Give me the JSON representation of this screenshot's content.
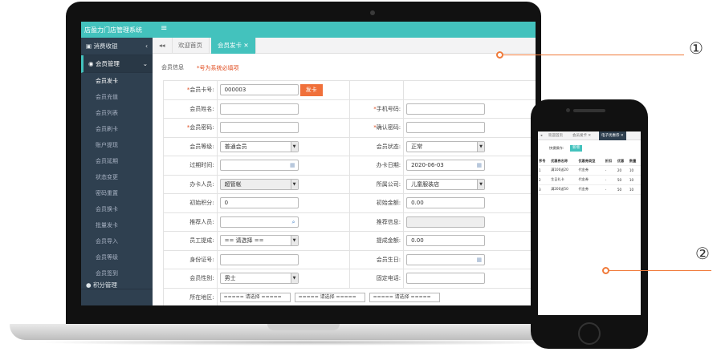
{
  "app": {
    "title": "店盈力门店管理系统",
    "menu_icon": "hamburger-icon"
  },
  "sidebar": {
    "groups": [
      {
        "label": "消费收银",
        "icon": "register-icon",
        "arrow": "‹"
      },
      {
        "label": "会员管理",
        "icon": "member-icon",
        "arrow": "⌄"
      }
    ],
    "items": [
      "会员发卡",
      "会员充值",
      "会员列表",
      "会员刷卡",
      "账户提现",
      "会员延期",
      "状态变更",
      "密码重置",
      "会员换卡",
      "批量发卡",
      "会员导入",
      "会员等级",
      "会员签到"
    ],
    "bottom_group": "积分管理"
  },
  "tabs": {
    "back_icon": "double-left-icon",
    "home": "欢迎首页",
    "active": "会员发卡",
    "close": "✕"
  },
  "form": {
    "section": "会员信息",
    "required_note": "*号为系统必填项",
    "rows": [
      {
        "l1": "会员卡号:",
        "s1": true,
        "v1": "000003",
        "btn": "发卡",
        "l2": "",
        "v2": null
      },
      {
        "l1": "会员姓名:",
        "v1": "",
        "l2": "手机号码:",
        "s2": true,
        "v2": ""
      },
      {
        "l1": "会员密码:",
        "s1": true,
        "v1": "",
        "l2": "确认密码:",
        "s2": true,
        "v2": ""
      },
      {
        "l1": "会员等级:",
        "v1": "普通会员",
        "sel1": true,
        "l2": "会员状态:",
        "v2": "正常",
        "sel2": true
      },
      {
        "l1": "过期时间:",
        "v1": "",
        "cal1": true,
        "l2": "办卡日期:",
        "v2": "2020-06-03",
        "cal2": true
      },
      {
        "l1": "办卡人员:",
        "v1": "超管帐",
        "sel1": true,
        "gray1": true,
        "l2": "所属公司:",
        "v2": "儿童服装店",
        "sel2": true
      },
      {
        "l1": "初始积分:",
        "v1": "0",
        "l2": "初始金额:",
        "v2": "0.00"
      },
      {
        "l1": "推荐人员:",
        "v1": "",
        "search1": true,
        "l2": "推荐信息:",
        "v2": "",
        "gray2": true
      },
      {
        "l1": "员工提成:",
        "v1": "== 请选择 ==",
        "sel1": true,
        "l2": "提成金额:",
        "v2": "0.00"
      },
      {
        "l1": "身份证号:",
        "v1": "",
        "l2": "会员生日:",
        "v2": "",
        "cal2": true
      },
      {
        "l1": "会员性别:",
        "v1": "男士",
        "sel1": true,
        "l2": "固定电话:",
        "v2": ""
      }
    ],
    "region_label": "所在地区:",
    "region_opts": [
      "===== 请选择 =====",
      "===== 请选择 =====",
      "===== 请选择 ====="
    ]
  },
  "callouts": {
    "one": "①",
    "two": "②"
  },
  "phone": {
    "tabs": [
      "欢迎首页",
      "会员发卡 ✕",
      "电子优惠券 ✕"
    ],
    "toolbar_label": "快捷操作:",
    "add_btn": "新增",
    "headers": [
      "序号",
      "优惠券名称",
      "优惠券类型",
      "折扣",
      "优惠",
      "数量"
    ],
    "rows": [
      [
        "1",
        "满100送20",
        "代金券",
        "-",
        "20",
        "10"
      ],
      [
        "2",
        "生日礼卡",
        "代金券",
        "-",
        "50",
        "10"
      ],
      [
        "3",
        "满200送50",
        "代金券",
        "-",
        "50",
        "10"
      ]
    ]
  },
  "colors": {
    "accent": "#43c2bd",
    "sidebar": "#2f4050",
    "orange": "#f0703a"
  }
}
